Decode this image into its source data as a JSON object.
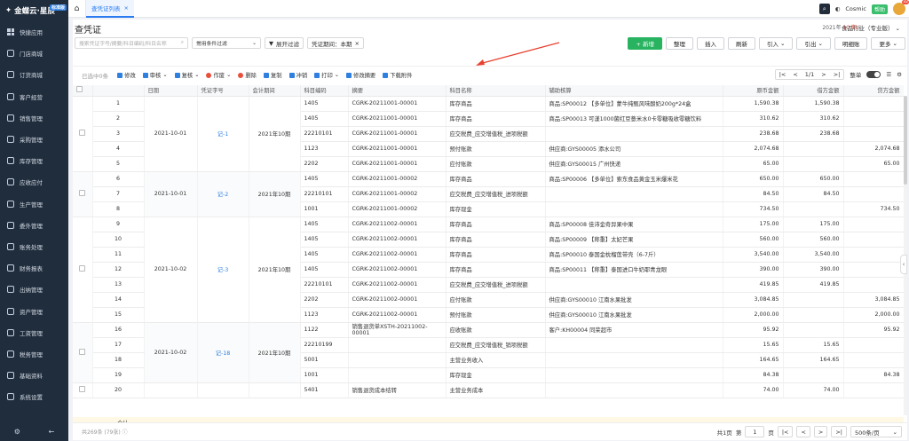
{
  "app": {
    "logo": "金蝶云·星辰",
    "logo_tag": "标准版"
  },
  "sidebar": {
    "items": [
      {
        "label": "快捷应用"
      },
      {
        "label": "门店商城"
      },
      {
        "label": "订货商城"
      },
      {
        "label": "客户经营"
      },
      {
        "label": "销售管理"
      },
      {
        "label": "采购管理"
      },
      {
        "label": "库存管理"
      },
      {
        "label": "应收应付"
      },
      {
        "label": "生产管理"
      },
      {
        "label": "委外管理"
      },
      {
        "label": "账务处理"
      },
      {
        "label": "财务报表"
      },
      {
        "label": "出纳管理"
      },
      {
        "label": "资产管理"
      },
      {
        "label": "工资管理"
      },
      {
        "label": "税务管理"
      },
      {
        "label": "基础资料"
      },
      {
        "label": "系统设置"
      }
    ]
  },
  "topbar": {
    "tab_label": "查凭证列表",
    "user": "Cosmic",
    "help": "帮助",
    "badge": "32"
  },
  "header": {
    "title": "查凭证",
    "period_year": "2021年",
    "period_month": "10 期",
    "industry": "食品行业（专业版）"
  },
  "filters": {
    "search_placeholder": "搜索凭证字号/摘要/科目编码/科目名称",
    "condition": "常用条件过滤",
    "expand": "展开过滤",
    "period_chip": "凭证期间：本期"
  },
  "actions": {
    "add": "+ 新增",
    "tidy": "整理",
    "insert": "插入",
    "refresh": "刷新",
    "import": "引入",
    "export": "引出",
    "clear": "明细账",
    "more": "更多"
  },
  "toolbar": {
    "selected": "已选中0条",
    "edit": "修改",
    "audit": "审核",
    "recheck": "复核",
    "void": "作废",
    "delete": "删除",
    "copy": "复制",
    "reverse": "冲销",
    "print": "打印",
    "edit_summary": "修改摘要",
    "download": "下载附件",
    "page": "1/1",
    "whole": "整单"
  },
  "table": {
    "headers": [
      "",
      "",
      "日期",
      "凭证字号",
      "会计期间",
      "科目编码",
      "摘要",
      "科目名称",
      "辅助核算",
      "原币金额",
      "借方金额",
      "贷方金额"
    ],
    "groups": [
      {
        "date": "2021-10-01",
        "voucher": "记-1",
        "period": "2021年10期",
        "rows": [
          {
            "n": "1",
            "code": "1405",
            "summary": "CGRK-20211001-00001",
            "subject": "库存商品",
            "aux": "商品:SP00012 【多单位】蒙牛纯甄风味酸奶200g*24盒",
            "amt": "1,590.38",
            "dr": "1,590.38",
            "cr": ""
          },
          {
            "n": "2",
            "code": "1405",
            "summary": "CGRK-20211001-00001",
            "subject": "库存商品",
            "aux": "商品:SP00013 可漾1000菌红豆薏米水0卡零糖吸收零糖饮料",
            "amt": "310.62",
            "dr": "310.62",
            "cr": ""
          },
          {
            "n": "3",
            "code": "22210101",
            "summary": "CGRK-20211001-00001",
            "subject": "应交税费_应交增值税_进项税额",
            "aux": "",
            "amt": "238.68",
            "dr": "238.68",
            "cr": ""
          },
          {
            "n": "4",
            "code": "1123",
            "summary": "CGRK-20211001-00001",
            "subject": "预付账款",
            "aux": "供应商:GYS00005 添水公司",
            "amt": "2,074.68",
            "dr": "",
            "cr": "2,074.68"
          },
          {
            "n": "5",
            "code": "2202",
            "summary": "CGRK-20211001-00001",
            "subject": "应付账款",
            "aux": "供应商:GYS00015 广州快递",
            "amt": "65.00",
            "dr": "",
            "cr": "65.00"
          }
        ]
      },
      {
        "date": "2021-10-01",
        "voucher": "记-2",
        "period": "2021年10期",
        "rows": [
          {
            "n": "6",
            "code": "1405",
            "summary": "CGRK-20211001-00002",
            "subject": "库存商品",
            "aux": "商品:SP00006 【多单位】索东食品黄金玉米爆米花",
            "amt": "650.00",
            "dr": "650.00",
            "cr": ""
          },
          {
            "n": "7",
            "code": "22210101",
            "summary": "CGRK-20211001-00002",
            "subject": "应交税费_应交增值税_进项税额",
            "aux": "",
            "amt": "84.50",
            "dr": "84.50",
            "cr": ""
          },
          {
            "n": "8",
            "code": "1001",
            "summary": "CGRK-20211001-00002",
            "subject": "库存现金",
            "aux": "",
            "amt": "734.50",
            "dr": "",
            "cr": "734.50"
          }
        ]
      },
      {
        "date": "2021-10-02",
        "voucher": "记-3",
        "period": "2021年10期",
        "rows": [
          {
            "n": "9",
            "code": "1405",
            "summary": "CGRK-20211002-00001",
            "subject": "库存商品",
            "aux": "商品:SP00008 佳沛金奇异果中果",
            "amt": "175.00",
            "dr": "175.00",
            "cr": ""
          },
          {
            "n": "10",
            "code": "1405",
            "summary": "CGRK-20211002-00001",
            "subject": "库存商品",
            "aux": "商品:SP00009 【称重】太妃芒果",
            "amt": "560.00",
            "dr": "560.00",
            "cr": ""
          },
          {
            "n": "11",
            "code": "1405",
            "summary": "CGRK-20211002-00001",
            "subject": "库存商品",
            "aux": "商品:SP00010 泰国金枕榴莲带壳（6-7斤）",
            "amt": "3,540.00",
            "dr": "3,540.00",
            "cr": ""
          },
          {
            "n": "12",
            "code": "1405",
            "summary": "CGRK-20211002-00001",
            "subject": "库存商品",
            "aux": "商品:SP00011 【称重】泰国进口牛奶耶青龙眼",
            "amt": "390.00",
            "dr": "390.00",
            "cr": ""
          },
          {
            "n": "13",
            "code": "22210101",
            "summary": "CGRK-20211002-00001",
            "subject": "应交税费_应交增值税_进项税额",
            "aux": "",
            "amt": "419.85",
            "dr": "419.85",
            "cr": ""
          },
          {
            "n": "14",
            "code": "2202",
            "summary": "CGRK-20211002-00001",
            "subject": "应付账款",
            "aux": "供应商:GYS00010 江南水果批发",
            "amt": "3,084.85",
            "dr": "",
            "cr": "3,084.85"
          },
          {
            "n": "15",
            "code": "1123",
            "summary": "CGRK-20211002-00001",
            "subject": "预付账款",
            "aux": "供应商:GYS00010 江南水果批发",
            "amt": "2,000.00",
            "dr": "",
            "cr": "2,000.00"
          }
        ]
      },
      {
        "date": "2021-10-02",
        "voucher": "记-18",
        "period": "2021年10期",
        "rows": [
          {
            "n": "16",
            "code": "1122",
            "summary": "销售退货单XSTH-20211002-00001",
            "subject": "应收账款",
            "aux": "客户:KH00004 同荣超市",
            "amt": "95.92",
            "dr": "",
            "cr": "95.92"
          },
          {
            "n": "17",
            "code": "22210199",
            "summary": "",
            "subject": "应交税费_应交增值税_销项税额",
            "aux": "",
            "amt": "15.65",
            "dr": "15.65",
            "cr": ""
          },
          {
            "n": "18",
            "code": "5001",
            "summary": "",
            "subject": "主营业务收入",
            "aux": "",
            "amt": "164.65",
            "dr": "164.65",
            "cr": ""
          },
          {
            "n": "19",
            "code": "1001",
            "summary": "",
            "subject": "库存现金",
            "aux": "",
            "amt": "84.38",
            "dr": "",
            "cr": "84.38"
          }
        ]
      },
      {
        "date": "",
        "voucher": "",
        "period": "",
        "rows": [
          {
            "n": "20",
            "code": "5401",
            "summary": "销售退货成本结转",
            "subject": "主营业务成本",
            "aux": "",
            "amt": "74.00",
            "dr": "74.00",
            "cr": ""
          }
        ]
      }
    ],
    "sum_label": "合计"
  },
  "footer": {
    "total": "共269条 (79张)",
    "pages": "共1页",
    "goto": "第",
    "page_num": "1",
    "page_unit": "页",
    "page_size": "500条/页"
  },
  "colors": {
    "sidebar": "#202d3d",
    "primary_green": "#27b35f",
    "link_blue": "#2f7fe0",
    "annotation_red": "#e8402e"
  }
}
